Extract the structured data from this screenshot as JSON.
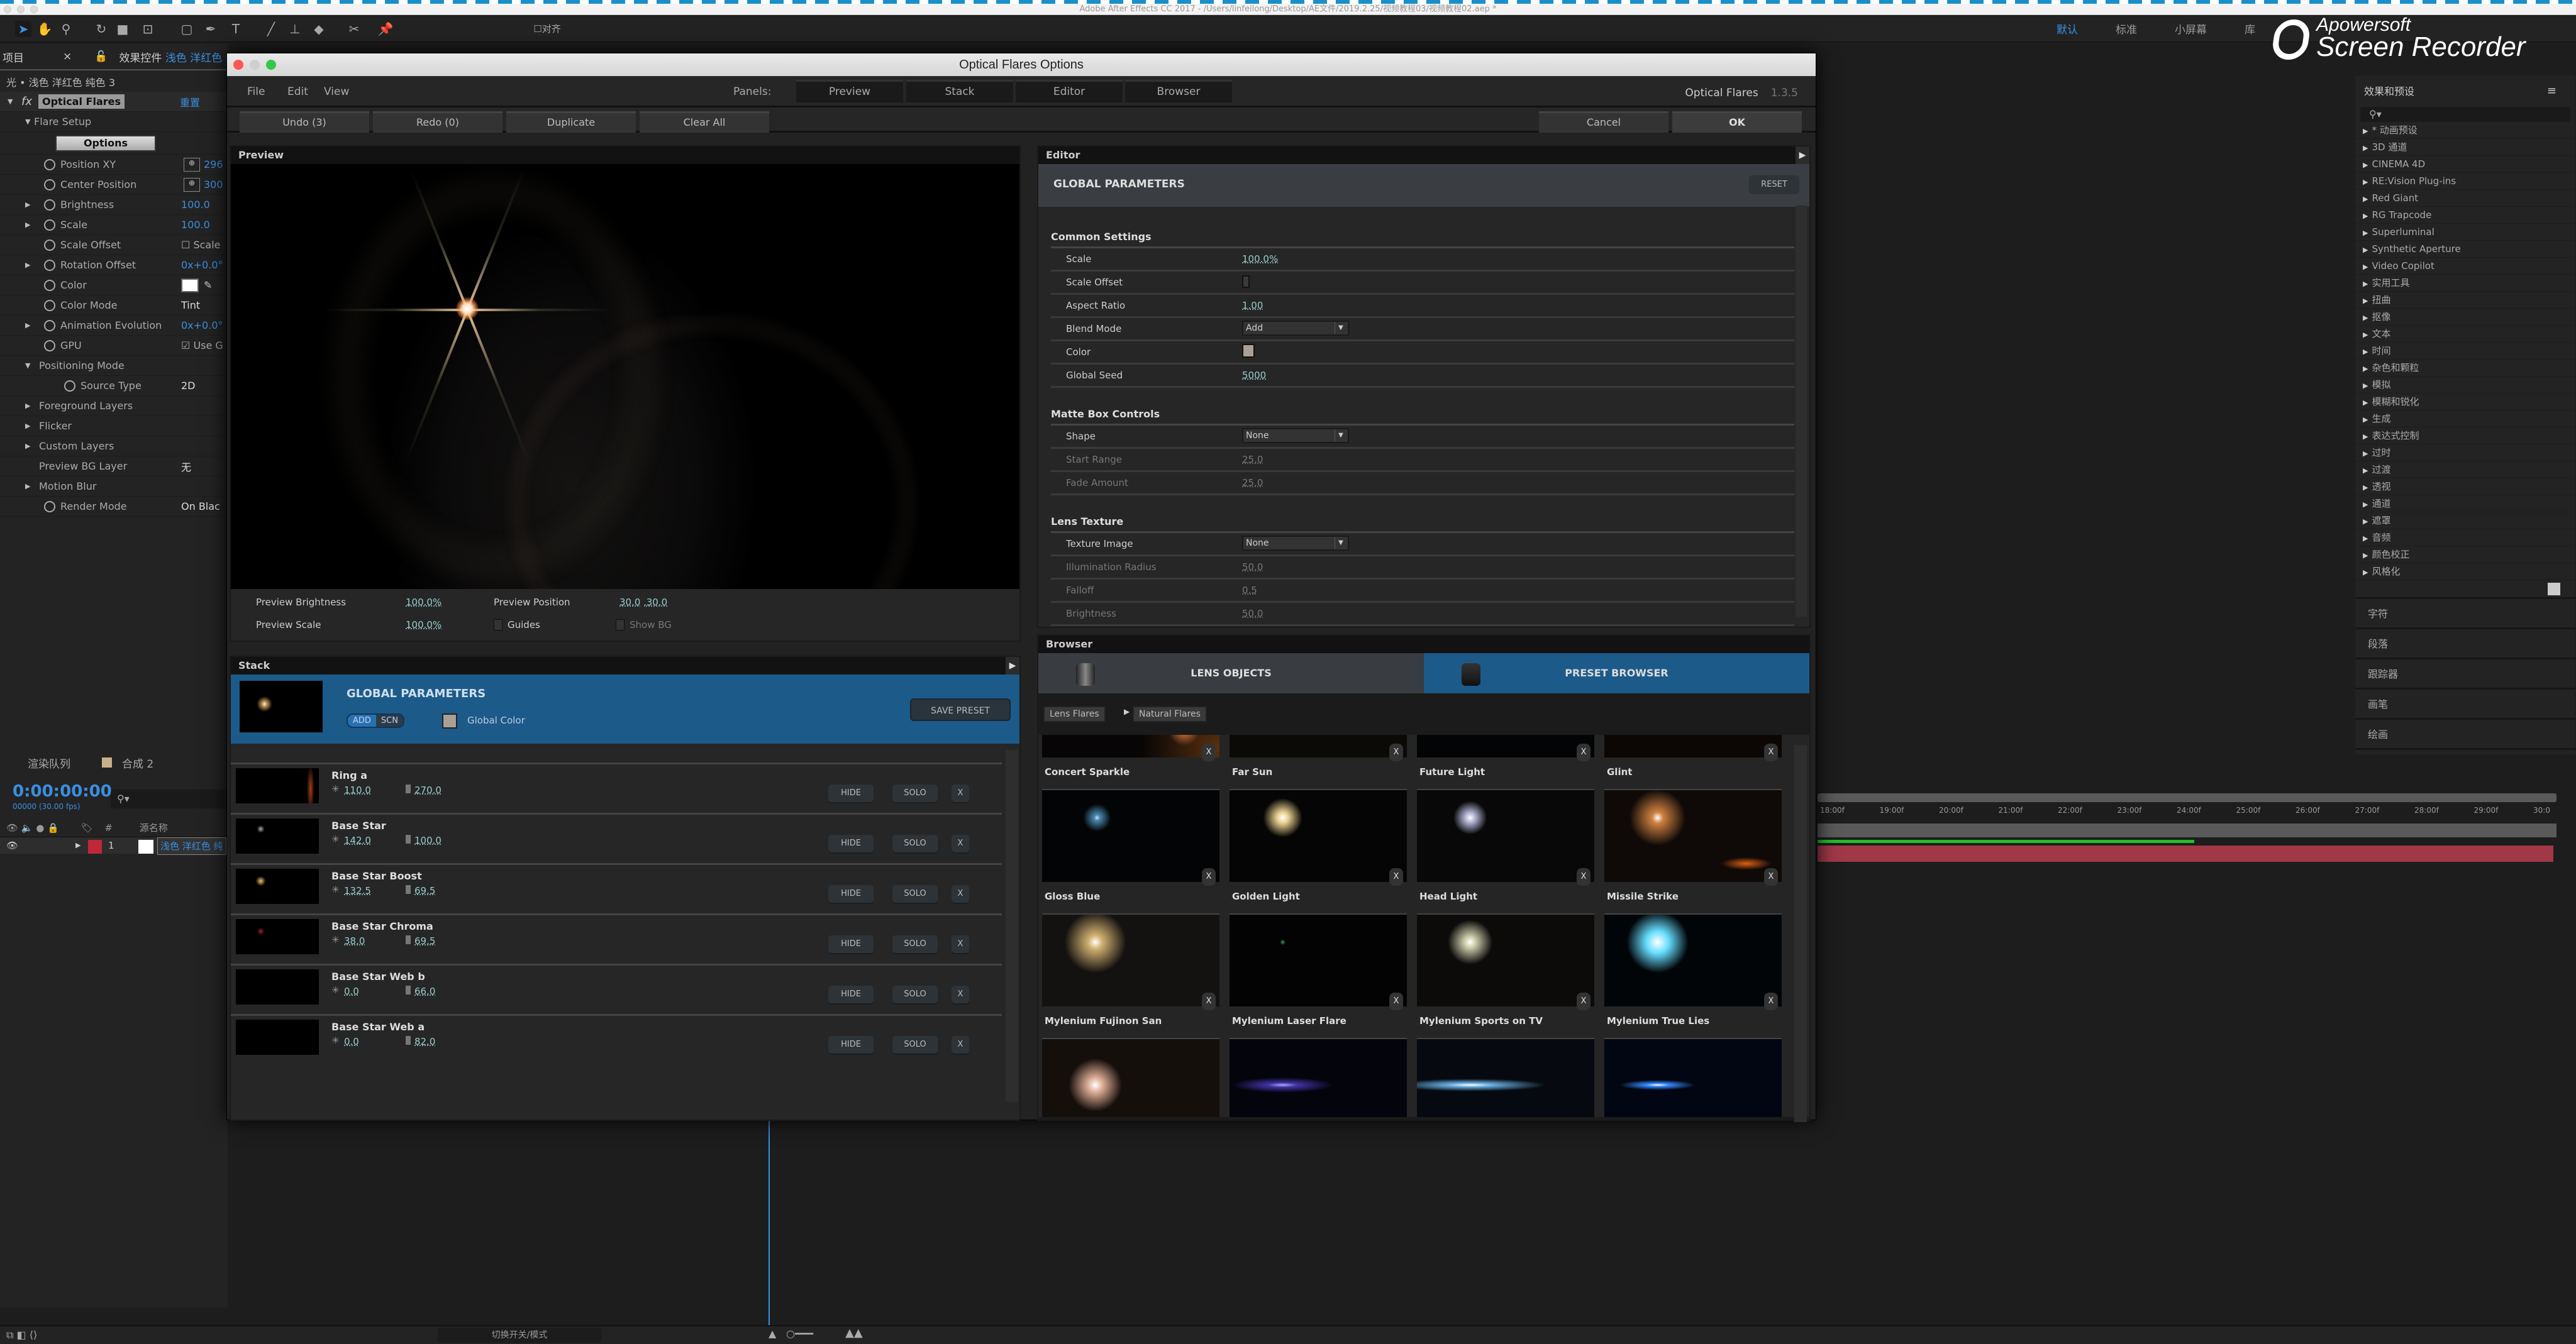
{
  "os": {
    "window_title": "Adobe After Effects CC 2017 - /Users/linfeilong/Desktop/AE文件/2019.2.25/视频教程03/视频教程02.aep *"
  },
  "ae_toolbar": {
    "tools": [
      "selection-tool",
      "hand-tool",
      "zoom-tool",
      "rotate-tool",
      "camera-tool",
      "pan-behind-tool",
      "rectangle-tool",
      "pen-tool",
      "type-tool",
      "brush-tool",
      "clone-stamp-tool",
      "eraser-tool",
      "roto-brush-tool",
      "puppet-pin-tool"
    ],
    "align_label": "对齐",
    "workspaces": [
      {
        "label": "默认",
        "active": true
      },
      {
        "label": "标准",
        "active": false
      },
      {
        "label": "小屏幕",
        "active": false
      },
      {
        "label": "库",
        "active": false
      }
    ]
  },
  "watermark": {
    "line1": "Apowersoft",
    "line2": "Screen Recorder"
  },
  "effect_controls": {
    "project_tab": "项目",
    "tab_label": "效果控件",
    "tab_layer": "浅色 洋红色 纯",
    "subtitle": "光 • 浅色 洋红色 纯色 3",
    "effect_name": "Optical Flares",
    "reset_label": "重置",
    "flare_setup": "Flare Setup",
    "options_button": "Options",
    "properties": [
      {
        "label": "Position XY",
        "value": "296",
        "target": true
      },
      {
        "label": "Center Position",
        "value": "300",
        "target": true
      },
      {
        "label": "Brightness",
        "value": "100.0",
        "expandable": true
      },
      {
        "label": "Scale",
        "value": "100.0",
        "expandable": true
      },
      {
        "label": "Scale Offset",
        "value": "Scale",
        "checkbox": true
      },
      {
        "label": "Rotation Offset",
        "value": "0x+0.0°",
        "expandable": true
      },
      {
        "label": "Color",
        "value": "",
        "color": "#ffffff"
      },
      {
        "label": "Color Mode",
        "value": "Tint"
      },
      {
        "label": "Animation Evolution",
        "value": "0x+0.0°",
        "expandable": true
      },
      {
        "label": "GPU",
        "value": "Use G",
        "checkbox": true,
        "checked": true
      }
    ],
    "positioning_mode": "Positioning Mode",
    "source_type": {
      "label": "Source Type",
      "value": "2D"
    },
    "groups": [
      "Foreground Layers",
      "Flicker",
      "Custom Layers"
    ],
    "preview_bg_layer": {
      "label": "Preview BG Layer",
      "value": "无"
    },
    "motion_blur": "Motion Blur",
    "render_mode": {
      "label": "Render Mode",
      "value": "On Blac"
    }
  },
  "timeline": {
    "render_queue_tab": "渲染队列",
    "comp_tab": "合成 2",
    "timecode": "0:00:00:00",
    "frame_info": "00000 (30.00 fps)",
    "column_header": "源名称",
    "layer": {
      "number": "1",
      "name": "浅色 洋红色 纯"
    },
    "ruler_ticks": [
      "18:00f",
      "19:00f",
      "20:00f",
      "21:00f",
      "22:00f",
      "23:00f",
      "24:00f",
      "25:00f",
      "26:00f",
      "27:00f",
      "28:00f",
      "29:00f",
      "30:0"
    ],
    "render_progress": 0.51,
    "switch_modes_label": "切换开关/模式"
  },
  "right_panel": {
    "title": "效果和预设",
    "categories": [
      "* 动画预设",
      "3D 通道",
      "CINEMA 4D",
      "RE:Vision Plug-ins",
      "Red Giant",
      "RG Trapcode",
      "Superluminal",
      "Synthetic Aperture",
      "Video Copilot",
      "实用工具",
      "扭曲",
      "抠像",
      "文本",
      "时间",
      "杂色和颗粒",
      "模拟",
      "模糊和锐化",
      "生成",
      "表达式控制",
      "过时",
      "过渡",
      "透视",
      "通道",
      "遮罩",
      "音频",
      "颜色校正",
      "风格化"
    ],
    "panels": [
      "字符",
      "段落",
      "跟踪器",
      "画笔",
      "绘画"
    ]
  },
  "dialog": {
    "title": "Optical Flares Options",
    "menu": [
      "File",
      "Edit",
      "View"
    ],
    "panels_label": "Panels:",
    "panel_tabs": [
      "Preview",
      "Stack",
      "Editor",
      "Browser"
    ],
    "brand": "Optical Flares",
    "version": "1.3.5",
    "actions": {
      "undo": "Undo (3)",
      "redo": "Redo (0)",
      "duplicate": "Duplicate",
      "clear_all": "Clear All",
      "cancel": "Cancel",
      "ok": "OK"
    },
    "preview": {
      "header": "Preview",
      "brightness_label": "Preview Brightness",
      "brightness_value": "100.0%",
      "scale_label": "Preview Scale",
      "scale_value": "100.0%",
      "position_label": "Preview Position",
      "position_x": "30.0",
      "position_y": ",30.0",
      "guides_label": "Guides",
      "show_bg_label": "Show BG"
    },
    "stack": {
      "header": "Stack",
      "global_title": "GLOBAL PARAMETERS",
      "add_label": "ADD",
      "scn_label": "SCN",
      "global_color_label": "Global Color",
      "global_color": "#a8a096",
      "save_preset": "SAVE PRESET",
      "hide_label": "HIDE",
      "solo_label": "SOLO",
      "remove_label": "X",
      "items": [
        {
          "name": "Ring a",
          "brightness": "110.0",
          "scale": "270.0"
        },
        {
          "name": "Base Star",
          "brightness": "142.0",
          "scale": "100.0"
        },
        {
          "name": "Base Star Boost",
          "brightness": "132.5",
          "scale": "69.5"
        },
        {
          "name": "Base Star Chroma",
          "brightness": "38.0",
          "scale": "69.5"
        },
        {
          "name": "Base Star Web b",
          "brightness": "0.0",
          "scale": "66.0"
        },
        {
          "name": "Base Star Web a",
          "brightness": "0.0",
          "scale": "82.0"
        }
      ]
    },
    "editor": {
      "header": "Editor",
      "title": "GLOBAL PARAMETERS",
      "reset": "RESET",
      "common": {
        "title": "Common Settings",
        "scale": {
          "label": "Scale",
          "value": "100.0%"
        },
        "scale_offset": {
          "label": "Scale Offset"
        },
        "aspect_ratio": {
          "label": "Aspect Ratio",
          "value": "1.00"
        },
        "blend_mode": {
          "label": "Blend Mode",
          "value": "Add"
        },
        "color": {
          "label": "Color",
          "value": "#a8a096"
        },
        "global_seed": {
          "label": "Global Seed",
          "value": "5000"
        }
      },
      "matte": {
        "title": "Matte Box Controls",
        "shape": {
          "label": "Shape",
          "value": "None"
        },
        "start_range": {
          "label": "Start Range",
          "value": "25.0"
        },
        "fade_amount": {
          "label": "Fade Amount",
          "value": "25.0"
        }
      },
      "lens": {
        "title": "Lens Texture",
        "texture_image": {
          "label": "Texture Image",
          "value": "None"
        },
        "illumination_radius": {
          "label": "Illumination Radius",
          "value": "50.0"
        },
        "falloff": {
          "label": "Falloff",
          "value": "0.5"
        },
        "brightness": {
          "label": "Brightness",
          "value": "50.0"
        }
      }
    },
    "browser": {
      "header": "Browser",
      "tab_lens": "LENS OBJECTS",
      "tab_preset": "PRESET BROWSER",
      "crumbs": [
        "Lens Flares",
        "Natural Flares"
      ],
      "presets": [
        "Concert Sparkle",
        "Far Sun",
        "Future Light",
        "Glint",
        "Gloss Blue",
        "Golden Light",
        "Head Light",
        "Missile Strike",
        "Mylenium Fujinon San",
        "Mylenium Laser Flare",
        "Mylenium Sports on TV",
        "Mylenium True Lies",
        "",
        "",
        "",
        ""
      ]
    }
  }
}
